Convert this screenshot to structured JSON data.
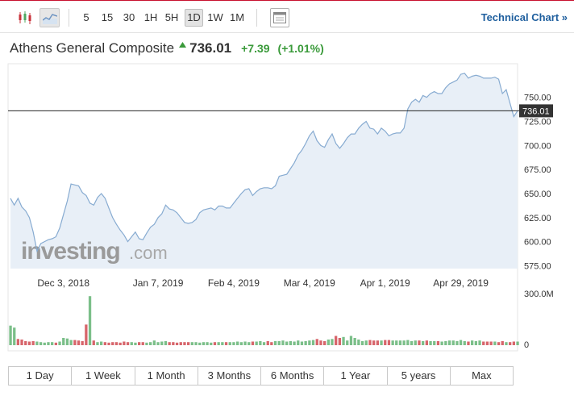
{
  "toolbar": {
    "timeframes": [
      "5",
      "15",
      "30",
      "1H",
      "5H",
      "1D",
      "1W",
      "1M"
    ],
    "active_timeframe": "1D",
    "active_chart_mode": "line",
    "technical_link": "Technical Chart »"
  },
  "quote": {
    "name": "Athens General Composite",
    "price": "736.01",
    "change": "+7.39",
    "change_pct": "(+1.01%)",
    "direction": "up",
    "up_color": "#3a9a3a"
  },
  "chart_data": {
    "type": "area",
    "price_series": {
      "values": [
        645,
        638,
        645,
        636,
        632,
        625,
        610,
        590,
        598,
        600,
        602,
        603,
        605,
        614,
        628,
        642,
        660,
        659,
        658,
        651,
        648,
        640,
        638,
        646,
        650,
        645,
        635,
        625,
        618,
        612,
        607,
        600,
        605,
        610,
        603,
        602,
        609,
        615,
        618,
        625,
        629,
        638,
        634,
        633,
        630,
        625,
        620,
        619,
        620,
        623,
        630,
        633,
        634,
        635,
        633,
        637,
        637,
        635,
        635,
        640,
        645,
        650,
        654,
        655,
        648,
        652,
        655,
        656,
        656,
        655,
        658,
        668,
        669,
        670,
        676,
        682,
        690,
        695,
        702,
        710,
        715,
        705,
        700,
        698,
        706,
        712,
        702,
        697,
        702,
        708,
        712,
        712,
        718,
        722,
        725,
        718,
        717,
        712,
        718,
        715,
        710,
        712,
        713,
        713,
        718,
        738,
        745,
        748,
        745,
        752,
        750,
        754,
        756,
        754,
        754,
        760,
        764,
        766,
        768,
        774,
        775,
        770,
        772,
        773,
        772,
        770,
        770,
        770,
        771,
        769,
        754,
        758,
        744,
        730,
        736.01
      ],
      "color": "#87abd1",
      "fill": "#e8eff7"
    },
    "volume_series": {
      "values": [
        38,
        34,
        12,
        11,
        8,
        7,
        8,
        7,
        6,
        5,
        6,
        6,
        5,
        7,
        14,
        13,
        10,
        10,
        9,
        8,
        40,
        95,
        9,
        6,
        7,
        6,
        5,
        6,
        6,
        5,
        7,
        6,
        6,
        5,
        6,
        6,
        5,
        6,
        9,
        6,
        7,
        8,
        6,
        6,
        5,
        6,
        6,
        6,
        6,
        6,
        5,
        6,
        6,
        5,
        6,
        6,
        6,
        6,
        6,
        6,
        7,
        6,
        7,
        6,
        7,
        7,
        8,
        6,
        8,
        6,
        8,
        8,
        9,
        7,
        8,
        7,
        9,
        7,
        8,
        9,
        10,
        12,
        9,
        8,
        11,
        12,
        18,
        14,
        16,
        9,
        18,
        14,
        11,
        8,
        9,
        10,
        9,
        9,
        9,
        10,
        10,
        9,
        9,
        9,
        9,
        10,
        8,
        9,
        9,
        8,
        9,
        8,
        8,
        8,
        7,
        8,
        9,
        9,
        8,
        10,
        8,
        7,
        9,
        8,
        9,
        7,
        7,
        7,
        7,
        6,
        8,
        6,
        6,
        7,
        7
      ],
      "up_color": "#4fa962",
      "down_color": "#c9313a",
      "direction": [
        "up",
        "up",
        "down",
        "down",
        "down",
        "down",
        "down",
        "up",
        "up",
        "up",
        "up",
        "up",
        "down",
        "up",
        "up",
        "up",
        "up",
        "down",
        "down",
        "down",
        "down",
        "up",
        "down",
        "up",
        "up",
        "down",
        "down",
        "down",
        "down",
        "down",
        "down",
        "down",
        "up",
        "up",
        "down",
        "down",
        "up",
        "up",
        "up",
        "up",
        "up",
        "up",
        "down",
        "down",
        "down",
        "down",
        "down",
        "down",
        "up",
        "up",
        "up",
        "up",
        "up",
        "up",
        "down",
        "up",
        "up",
        "down",
        "up",
        "up",
        "up",
        "up",
        "up",
        "up",
        "down",
        "up",
        "up",
        "up",
        "down",
        "down",
        "up",
        "up",
        "up",
        "up",
        "up",
        "up",
        "up",
        "up",
        "up",
        "up",
        "up",
        "down",
        "down",
        "down",
        "up",
        "up",
        "down",
        "down",
        "up",
        "up",
        "up",
        "up",
        "up",
        "up",
        "up",
        "down",
        "down",
        "down",
        "up",
        "down",
        "down",
        "up",
        "up",
        "up",
        "up",
        "up",
        "up",
        "up",
        "down",
        "up",
        "down",
        "up",
        "up",
        "down",
        "up",
        "up",
        "up",
        "up",
        "up",
        "up",
        "up",
        "down",
        "up",
        "up",
        "up",
        "down",
        "down",
        "down",
        "up",
        "down",
        "down",
        "up",
        "down",
        "down",
        "up"
      ]
    },
    "y_ticks": [
      "750.00",
      "725.00",
      "700.00",
      "675.00",
      "650.00",
      "625.00",
      "600.00",
      "575.00"
    ],
    "y_tick_values": [
      750,
      725,
      700,
      675,
      650,
      625,
      600,
      575
    ],
    "ylim": [
      572,
      785
    ],
    "x_ticks": [
      "Dec 3, 2018",
      "Jan 7, 2019",
      "Feb 4, 2019",
      "Mar 4, 2019",
      "Apr 1, 2019",
      "Apr 29, 2019"
    ],
    "x_tick_index": [
      14,
      39,
      59,
      79,
      99,
      119
    ],
    "last_price_label": "736.01",
    "last_price": 736.01,
    "volume_ticks": [
      "300.0M",
      "0"
    ],
    "volume_max": 300,
    "grid": false,
    "watermark_text": "investing",
    "watermark_suffix": ".com"
  },
  "periods": [
    "1 Day",
    "1 Week",
    "1 Month",
    "3 Months",
    "6 Months",
    "1 Year",
    "5 years",
    "Max"
  ]
}
